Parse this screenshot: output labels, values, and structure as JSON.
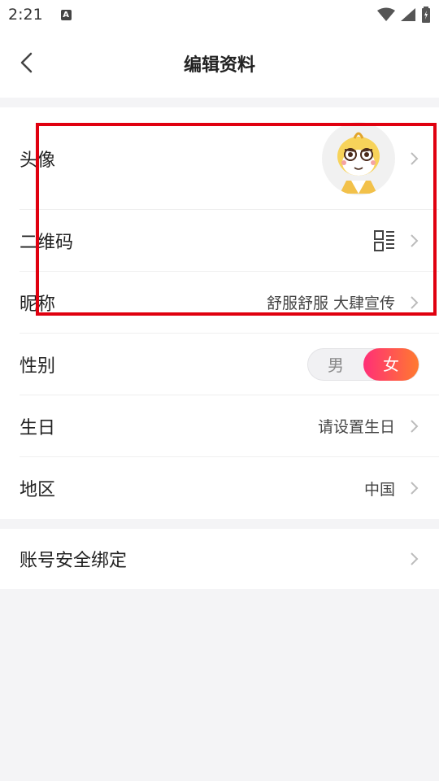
{
  "status": {
    "time": "2:21",
    "a_icon": "A"
  },
  "header": {
    "title": "编辑资料"
  },
  "profile": {
    "avatar_label": "头像",
    "qr_label": "二维码",
    "nickname_label": "昵称",
    "nickname_value": "舒服舒服 大肆宣传",
    "gender_label": "性别",
    "gender_male": "男",
    "gender_female": "女",
    "birthday_label": "生日",
    "birthday_value": "请设置生日",
    "region_label": "地区",
    "region_value": "中国"
  },
  "account": {
    "security_label": "账号安全绑定"
  },
  "colors": {
    "accent_start": "#ff2f77",
    "accent_end": "#ff7a2f",
    "highlight_box": "#e0000f"
  }
}
